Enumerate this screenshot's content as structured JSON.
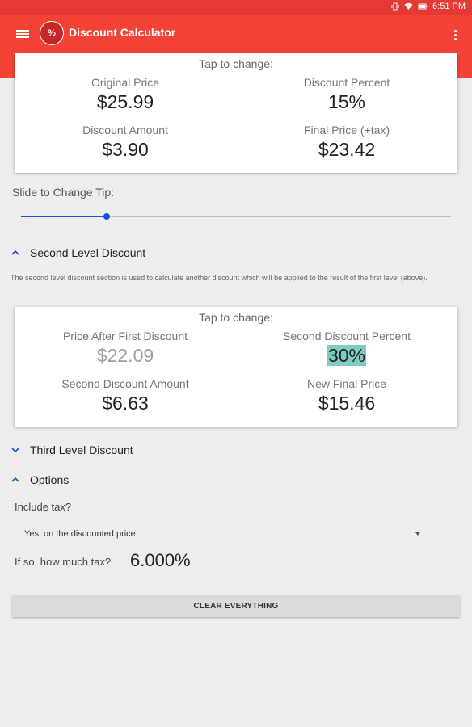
{
  "status": {
    "time": "6:51 PM"
  },
  "app": {
    "title": "Discount Calculator",
    "logo_text": "%",
    "accent": "#f44336",
    "statusbar_color": "#e53935"
  },
  "first_level": {
    "tap_hint": "Tap to change:",
    "original_price_label": "Original Price",
    "original_price": "$25.99",
    "discount_percent_label": "Discount Percent",
    "discount_percent": "15%",
    "discount_amount_label": "Discount Amount",
    "discount_amount": "$3.90",
    "final_price_label": "Final Price (+tax)",
    "final_price": "$23.42"
  },
  "tip_slider": {
    "label": "Slide to Change Tip:",
    "value_fraction": 0.2,
    "color": "#1e4fd8"
  },
  "second_level": {
    "header": "Second Level Discount",
    "description": "The second level discount section is used to calculate another discount which will be applied to the result of the first level (above).",
    "tap_hint": "Tap to change:",
    "price_after_first_label": "Price After First Discount",
    "price_after_first": "$22.09",
    "second_percent_label": "Second Discount Percent",
    "second_percent": "30%",
    "second_amount_label": "Second Discount Amount",
    "second_amount": "$6.63",
    "new_final_label": "New Final Price",
    "new_final": "$15.46",
    "highlight_color": "#80cbc4"
  },
  "third_level": {
    "header": "Third Level Discount"
  },
  "options": {
    "header": "Options",
    "include_tax_label": "Include tax?",
    "include_tax_value": "Yes, on the discounted price.",
    "tax_amount_label": "If so, how much tax?",
    "tax_amount": "6.000%"
  },
  "clear_button": "CLEAR EVERYTHING"
}
